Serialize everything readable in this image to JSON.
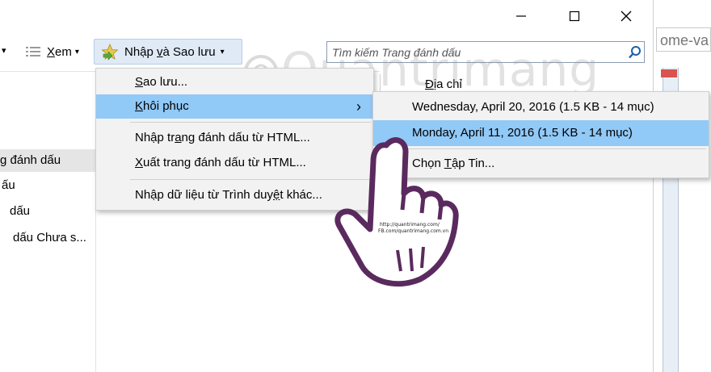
{
  "window_controls": {
    "minimize": "—",
    "maximize": "☐",
    "close": "✕"
  },
  "background_window": {
    "url_fragment": "ome-va"
  },
  "toolbar": {
    "view_label_pre": "",
    "view_label_u": "X",
    "view_label_post": "em",
    "import_label_pre": "Nhập ",
    "import_label_u": "v",
    "import_label_post": "à Sao lưu",
    "dropdown_arrow": "▾",
    "left_arrow": "▾"
  },
  "search": {
    "placeholder": "Tìm kiếm Trang đánh dấu"
  },
  "watermark": "Quantrimang",
  "tree": {
    "items": [
      {
        "label": "g đánh dấu"
      },
      {
        "label": "ấu"
      },
      {
        "label": "dấu"
      },
      {
        "label": "dấu Chưa s..."
      }
    ]
  },
  "column_header": {
    "address_label_pre": "Đ",
    "address_label_post": "ịa chỉ"
  },
  "menu": {
    "items": [
      {
        "pre": "",
        "u": "S",
        "post": "ao lưu..."
      },
      {
        "pre": "",
        "u": "K",
        "post": "hôi phục",
        "arrow": "›"
      },
      {
        "pre": "Nhập tr",
        "u": "a",
        "post": "ng đánh dấu từ HTML..."
      },
      {
        "pre": "",
        "u": "X",
        "post": "uất trang đánh dấu từ HTML..."
      },
      {
        "pre": "Nhập dữ liệu từ Trình duy",
        "u": "ệ",
        "post": "t khác..."
      }
    ]
  },
  "submenu": {
    "items": [
      {
        "label": "Wednesday, April 20, 2016 (1.5 KB - 14 mục)"
      },
      {
        "label": "Monday, April 11, 2016 (1.5 KB - 14 mục)"
      },
      {
        "pre": "Chọn ",
        "u": "T",
        "post": "ập Tin..."
      }
    ]
  },
  "hand_text": {
    "line1": "http://quantrimang.com/",
    "line2": "FB.com/quantrimang.com.vn"
  }
}
